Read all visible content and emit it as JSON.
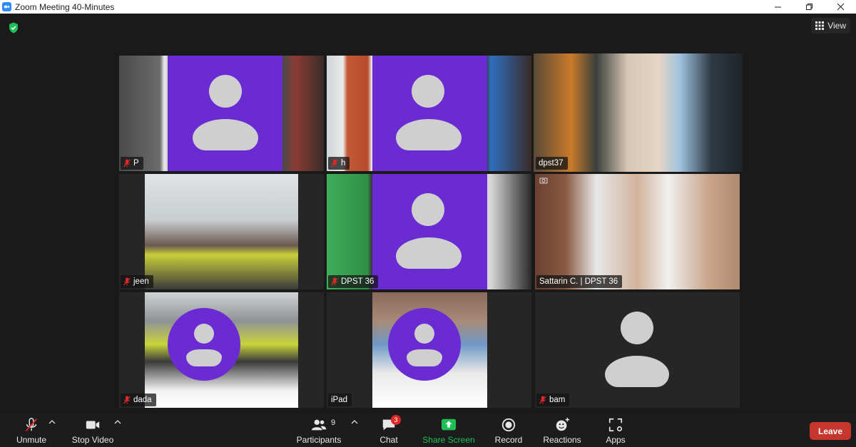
{
  "window": {
    "title": "Zoom Meeting 40-Minutes"
  },
  "header": {
    "view_label": "View"
  },
  "tiles": [
    {
      "name": "P",
      "muted": true
    },
    {
      "name": "h",
      "muted": true
    },
    {
      "name": "dpst37",
      "muted": false
    },
    {
      "name": "jeen",
      "muted": true
    },
    {
      "name": "DPST 36",
      "muted": true
    },
    {
      "name": "Sattarin C. | DPST 36",
      "muted": false
    },
    {
      "name": "dada",
      "muted": true
    },
    {
      "name": "iPad",
      "muted": false
    },
    {
      "name": "bam",
      "muted": true
    }
  ],
  "toolbar": {
    "unmute_label": "Unmute",
    "stop_video_label": "Stop Video",
    "participants_label": "Participants",
    "participants_count": "9",
    "chat_label": "Chat",
    "chat_badge": "3",
    "share_label": "Share Screen",
    "record_label": "Record",
    "reactions_label": "Reactions",
    "apps_label": "Apps",
    "leave_label": "Leave"
  },
  "colors": {
    "avatar_purple": "#6a2bd2",
    "active_speaker_border": "#e7e47a",
    "share_green": "#1ebf57",
    "leave_red": "#c7362c",
    "mute_red": "#e02828"
  }
}
